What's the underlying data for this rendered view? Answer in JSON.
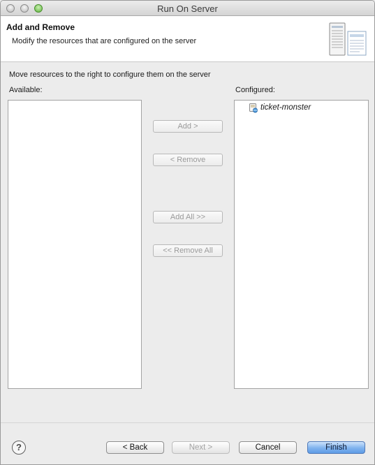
{
  "window": {
    "title": "Run On Server"
  },
  "header": {
    "title": "Add and Remove",
    "description": "Modify the resources that are configured on the server",
    "graphic_icon": "server-icon"
  },
  "main": {
    "instructions": "Move resources to the right to configure them on the server",
    "available_label": "Available:",
    "configured_label": "Configured:",
    "available_items": [],
    "configured_items": [
      {
        "label": "ticket-monster",
        "icon": "web-module-icon"
      }
    ]
  },
  "move_buttons": {
    "add": "Add >",
    "remove": "< Remove",
    "add_all": "Add All >>",
    "remove_all": "<< Remove All"
  },
  "footer": {
    "help_icon": "help-icon",
    "help_glyph": "?",
    "back": "< Back",
    "next": "Next >",
    "cancel": "Cancel",
    "finish": "Finish"
  },
  "colors": {
    "default_button": "#6fa6ea",
    "dialog_bg": "#ececec",
    "disabled_text": "#9a9a9a"
  }
}
